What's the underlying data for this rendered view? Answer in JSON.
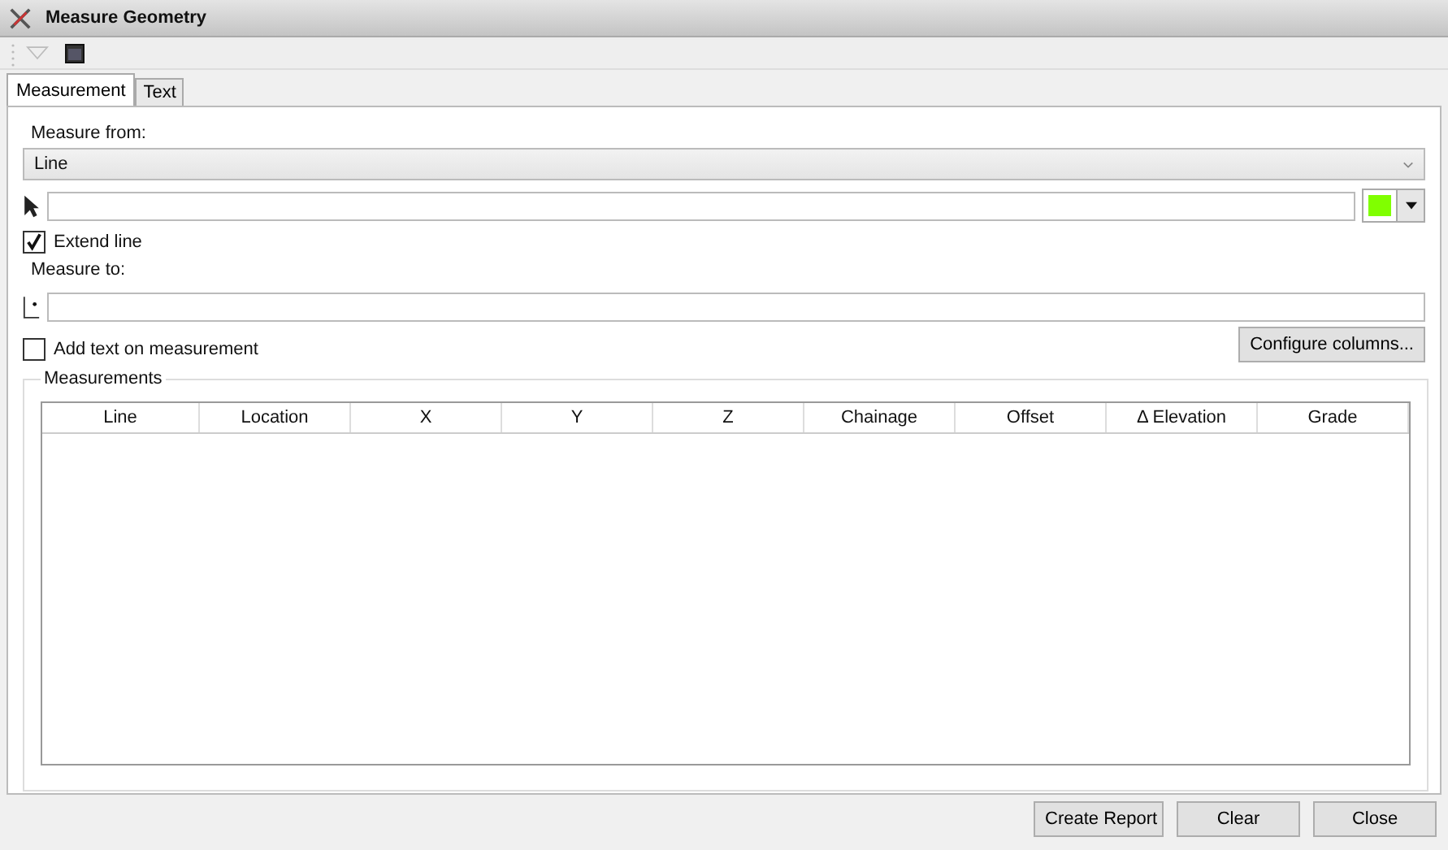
{
  "window": {
    "title": "Measure Geometry"
  },
  "tabs": [
    {
      "label": "Measurement",
      "selected": true
    },
    {
      "label": "Text",
      "selected": false
    }
  ],
  "measure_from": {
    "label": "Measure from:",
    "value": "Line",
    "color": "#80ff00"
  },
  "extend_line": {
    "label": "Extend line",
    "checked": true
  },
  "measure_to": {
    "label": "Measure to:"
  },
  "add_text": {
    "label": "Add text on measurement",
    "checked": false
  },
  "configure_button": "Configure columns...",
  "measurements": {
    "title": "Measurements",
    "columns": [
      "Line",
      "Location",
      "X",
      "Y",
      "Z",
      "Chainage",
      "Offset",
      "Δ Elevation",
      "Grade"
    ]
  },
  "buttons": [
    "Create Report",
    "Clear",
    "Close"
  ]
}
